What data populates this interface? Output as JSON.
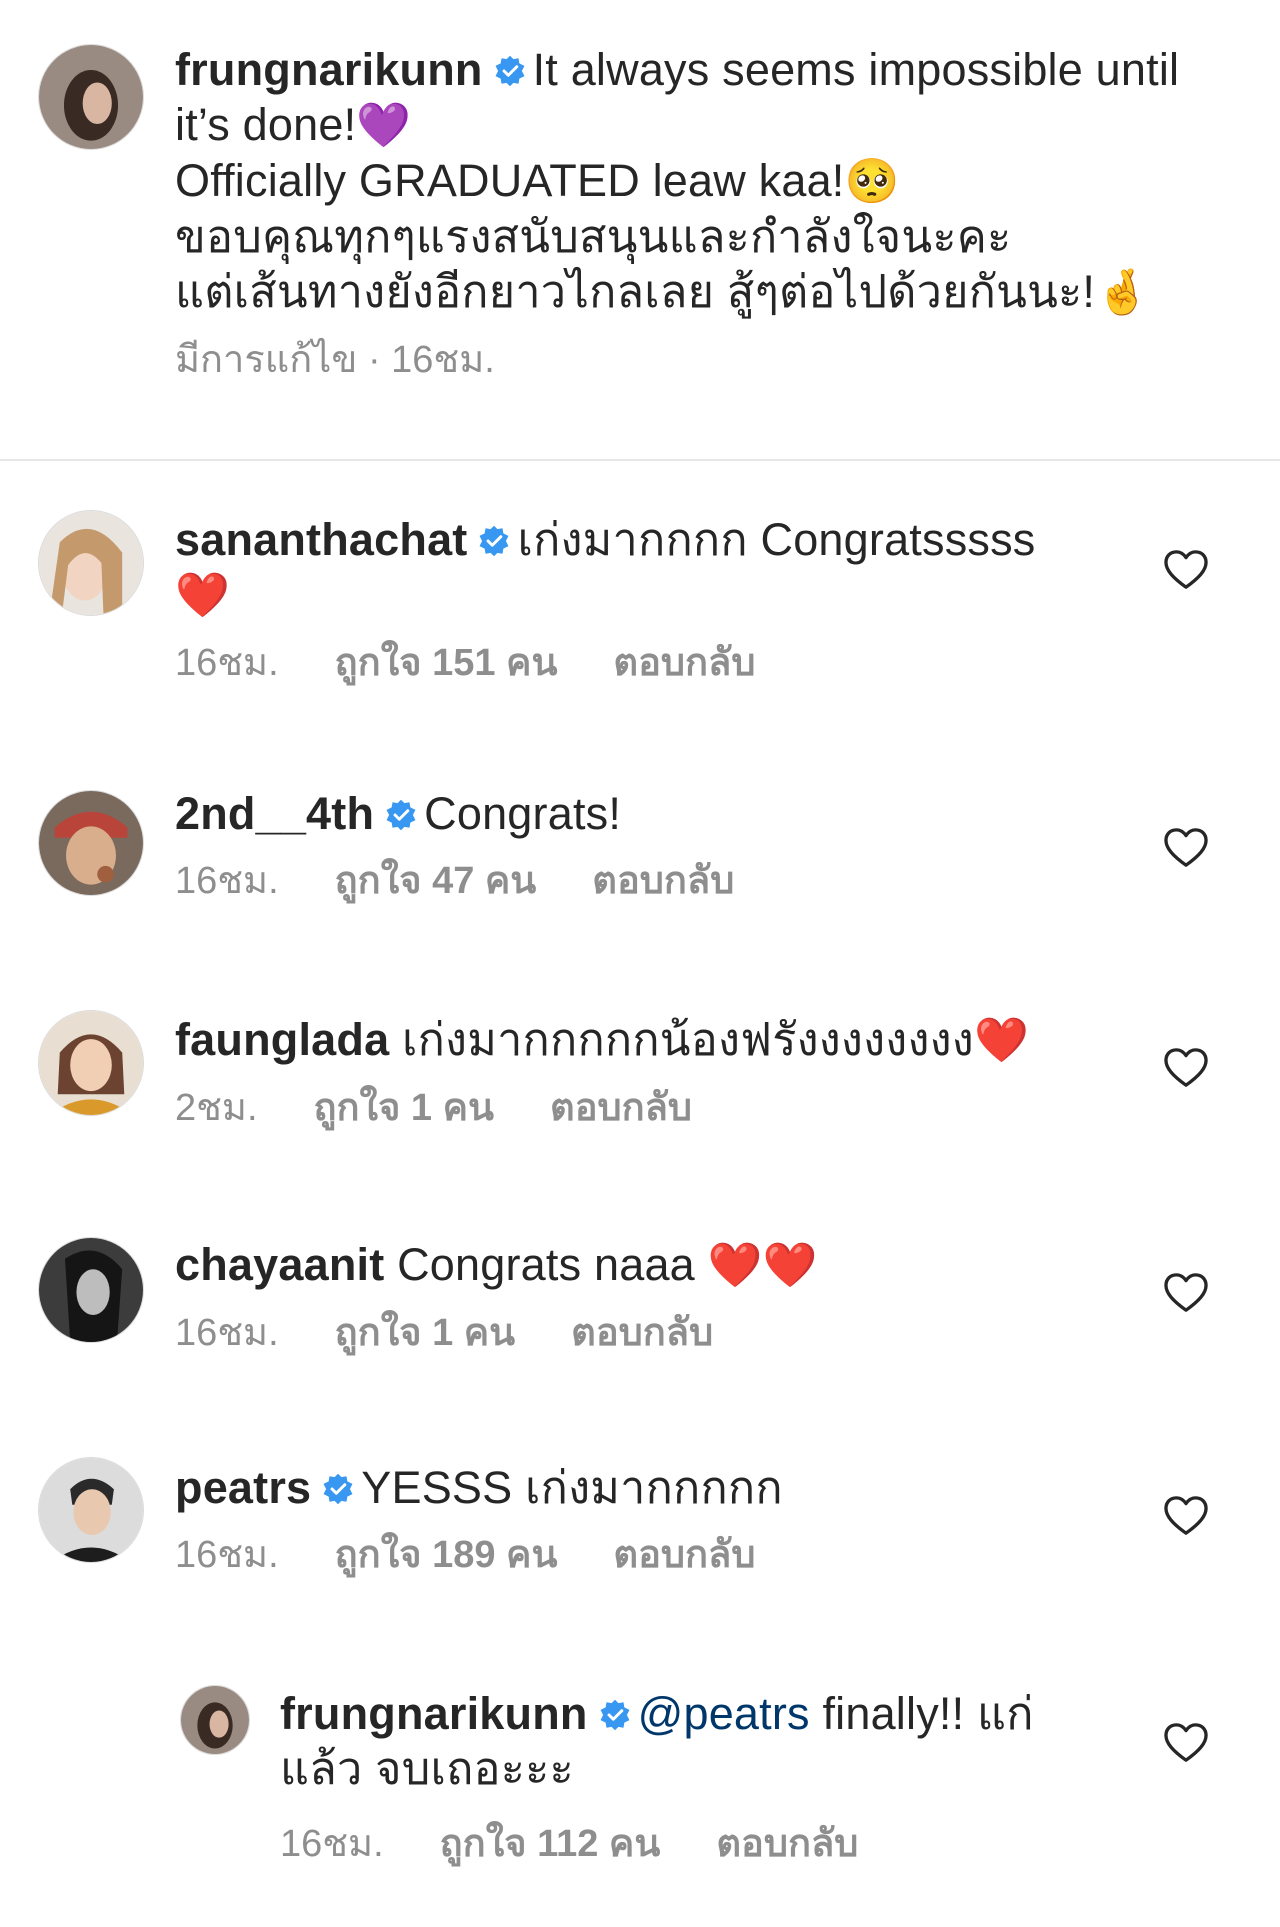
{
  "post_caption": {
    "username": "frungnarikunn",
    "verified": true,
    "text_line1": "It always seems impossible until",
    "text_line2": "it’s done!",
    "emoji_after_line2": "💜",
    "text_line3": "Officially GRADUATED leaw kaa!",
    "emoji_after_line3": "🥺",
    "text_line4": "ขอบคุณทุกๆแรงสนับสนุนและกำลังใจนะคะ",
    "text_line5": "แต่เส้นทางยังอีกยาวไกลเลย สู้ๆต่อไปด้วยกันนะ!",
    "emoji_after_line5": "🤞",
    "meta": "มีการแก้ไข · 16ชม."
  },
  "comments": [
    {
      "username": "sananthachat",
      "verified": true,
      "text": "เก่งมากกกก Congratsssss",
      "emoji": "❤️",
      "time": "16ชม.",
      "likes": "ถูกใจ 151 คน",
      "reply": "ตอบกลับ"
    },
    {
      "username": "2nd__4th",
      "verified": true,
      "text": "Congrats!",
      "time": "16ชม.",
      "likes": "ถูกใจ 47 คน",
      "reply": "ตอบกลับ"
    },
    {
      "username": "faunglada",
      "verified": false,
      "text": "เก่งมากกกกกน้องฟรังงงงงงงง",
      "emoji": "❤️",
      "time": "2ชม.",
      "likes": "ถูกใจ 1 คน",
      "reply": "ตอบกลับ"
    },
    {
      "username": "chayaanit",
      "verified": false,
      "text": "Congrats naaa",
      "emoji": "❤️❤️",
      "time": "16ชม.",
      "likes": "ถูกใจ 1 คน",
      "reply": "ตอบกลับ"
    },
    {
      "username": "peatrs",
      "verified": true,
      "text": "YESSS เก่งมากกกกก",
      "time": "16ชม.",
      "likes": "ถูกใจ 189 คน",
      "reply": "ตอบกลับ"
    }
  ],
  "reply_comment": {
    "username": "frungnarikunn",
    "verified": true,
    "mention": "@peatrs",
    "text_line1": "finally!! แก่",
    "text_line2": "แล้ว จบเถอะะะ",
    "time": "16ชม.",
    "likes": "ถูกใจ 112 คน",
    "reply": "ตอบกลับ"
  },
  "colors": {
    "verified_badge": "#3897f0",
    "meta_text": "#8e8e8e",
    "mention_link": "#00376b",
    "divider": "#e6e6e6"
  },
  "icons": {
    "verified": "verified-badge-icon",
    "like": "heart-outline-icon"
  }
}
